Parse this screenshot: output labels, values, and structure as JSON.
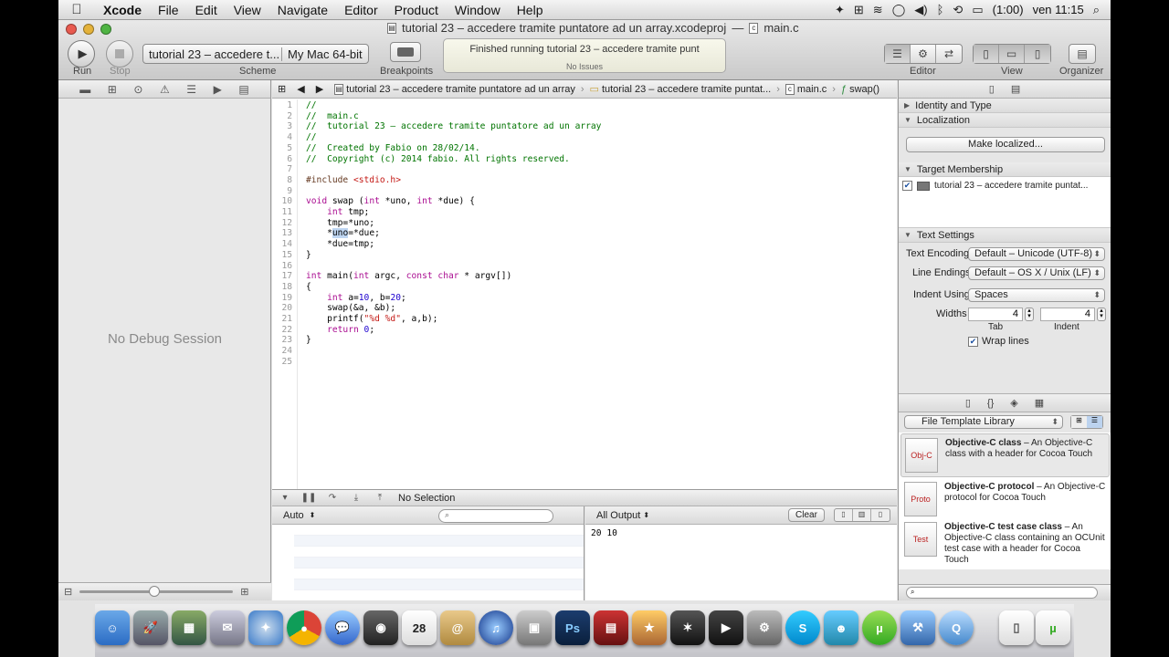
{
  "menubar": {
    "app": "Xcode",
    "items": [
      "File",
      "Edit",
      "View",
      "Navigate",
      "Editor",
      "Product",
      "Window",
      "Help"
    ],
    "battery": "(1:00)",
    "clock": "ven 11:15"
  },
  "window": {
    "title": "tutorial 23 – accedere tramite puntatore ad un array.xcodeproj",
    "separator": "—",
    "file": "main.c"
  },
  "toolbar": {
    "run_label": "Run",
    "stop_label": "Stop",
    "scheme_target": "tutorial 23 – accedere t...",
    "scheme_dest": "My Mac 64-bit",
    "scheme_label": "Scheme",
    "breakpoints_label": "Breakpoints",
    "activity_message": "Finished running tutorial 23 – accedere tramite punt",
    "activity_status": "No Issues",
    "editor_label": "Editor",
    "view_label": "View",
    "organizer_label": "Organizer"
  },
  "navigator": {
    "empty_message": "No Debug Session"
  },
  "jumpbar": {
    "project": "tutorial 23 – accedere tramite puntatore ad un array",
    "group": "tutorial 23 – accedere tramite puntat...",
    "file": "main.c",
    "symbol": "swap()"
  },
  "code": {
    "line_numbers": [
      "1",
      "2",
      "3",
      "4",
      "5",
      "6",
      "7",
      "8",
      "9",
      "10",
      "11",
      "12",
      "13",
      "14",
      "15",
      "16",
      "17",
      "18",
      "19",
      "20",
      "21",
      "22",
      "23",
      "24",
      "25"
    ]
  },
  "debug": {
    "selection": "No Selection",
    "variables_scope": "Auto",
    "output_scope": "All Output",
    "clear_label": "Clear",
    "console_output": "20 10"
  },
  "utilities": {
    "identity_section": "Identity and Type",
    "localization_section": "Localization",
    "make_localized": "Make localized...",
    "target_section": "Target Membership",
    "target_name": "tutorial 23 – accedere tramite puntat...",
    "text_section": "Text Settings",
    "text_encoding_label": "Text Encoding",
    "text_encoding_value": "Default – Unicode (UTF-8)",
    "line_endings_label": "Line Endings",
    "line_endings_value": "Default – OS X / Unix (LF)",
    "indent_using_label": "Indent Using",
    "indent_using_value": "Spaces",
    "widths_label": "Widths",
    "tab_width": "4",
    "indent_width": "4",
    "tab_label": "Tab",
    "indent_label": "Indent",
    "wrap_lines": "Wrap lines",
    "library_popup": "File Template Library",
    "library": [
      {
        "icon_text": "Obj-C",
        "title": "Objective-C class",
        "desc": " – An Objective-C class with a header for Cocoa Touch"
      },
      {
        "icon_text": "Proto",
        "title": "Objective-C protocol",
        "desc": " – An Objective-C protocol for Cocoa Touch"
      },
      {
        "icon_text": "Test",
        "title": "Objective-C test case class",
        "desc": " – An Objective-C class containing an OCUnit test case with a header for Cocoa Touch"
      }
    ]
  },
  "dock": {
    "calendar_day": "28"
  },
  "colors": {
    "comment": "#007400",
    "keyword": "#aa0d91",
    "preprocessor": "#643820",
    "string": "#c41a16",
    "number": "#1c00cf",
    "selection": "#bfd6f2"
  }
}
